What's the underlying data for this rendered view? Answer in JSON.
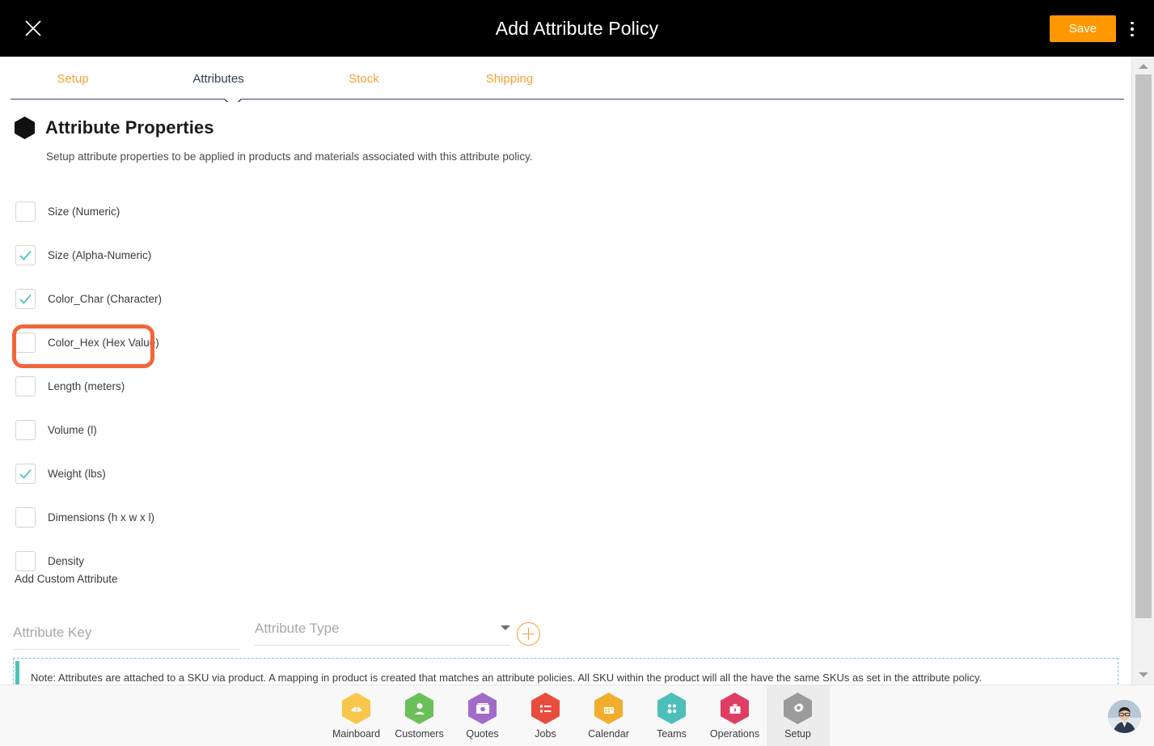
{
  "window": {
    "title": "Add Attribute Policy",
    "close_icon": "close-icon",
    "save_label": "Save",
    "menu_icon": "kebab-menu-icon",
    "accent_orange": "#FF9800",
    "tab_orange": "#F5A033",
    "highlight_orange": "#F2653A",
    "check_teal": "#52c2bd"
  },
  "tabs": [
    {
      "label": "Setup",
      "active": false
    },
    {
      "label": "Attributes",
      "active": true
    },
    {
      "label": "Stock",
      "active": false
    },
    {
      "label": "Shipping",
      "active": false
    }
  ],
  "section": {
    "icon": "hexagon-icon",
    "title": "Attribute Properties",
    "subtitle": "Setup attribute properties to be applied in products and materials associated with this attribute policy."
  },
  "attributes": [
    {
      "label": "Size (Numeric)",
      "checked": false,
      "highlighted": false
    },
    {
      "label": "Size (Alpha-Numeric)",
      "checked": true,
      "highlighted": true
    },
    {
      "label": "Color_Char (Character)",
      "checked": true,
      "highlighted": false
    },
    {
      "label": "Color_Hex (Hex Value)",
      "checked": false,
      "highlighted": false
    },
    {
      "label": "Length (meters)",
      "checked": false,
      "highlighted": false
    },
    {
      "label": "Volume (l)",
      "checked": false,
      "highlighted": false
    },
    {
      "label": "Weight (lbs)",
      "checked": true,
      "highlighted": false
    },
    {
      "label": "Dimensions (h x w x l)",
      "checked": false,
      "highlighted": false
    },
    {
      "label": "Density",
      "checked": false,
      "highlighted": false
    }
  ],
  "custom_attribute": {
    "heading": "Add Custom Attribute",
    "key_placeholder": "Attribute Key",
    "key_value": "",
    "type_placeholder": "Attribute Type",
    "type_value": "",
    "dropdown_icon": "chevron-down-icon",
    "add_icon": "plus-circle-icon"
  },
  "note": {
    "text": "Note: Attributes are attached to a SKU via product. A mapping in product is created that matches an attribute policies. All SKU within the product will all the have the same SKUs as set in the attribute policy."
  },
  "scrollbar": {
    "up_icon": "scroll-up-arrow-icon",
    "down_icon": "scroll-down-arrow-icon"
  },
  "bottom_nav": {
    "items": [
      {
        "label": "Mainboard",
        "icon": "mainboard-icon",
        "color": "#F7C64B",
        "active": false
      },
      {
        "label": "Customers",
        "icon": "customers-icon",
        "color": "#6BBF59",
        "active": false
      },
      {
        "label": "Quotes",
        "icon": "quotes-icon",
        "color": "#A06CC8",
        "active": false
      },
      {
        "label": "Jobs",
        "icon": "jobs-icon",
        "color": "#E84C3D",
        "active": false
      },
      {
        "label": "Calendar",
        "icon": "calendar-icon",
        "color": "#F0AD2E",
        "active": false
      },
      {
        "label": "Teams",
        "icon": "teams-icon",
        "color": "#4CBFBB",
        "active": false
      },
      {
        "label": "Operations",
        "icon": "operations-icon",
        "color": "#DE3E63",
        "active": false
      },
      {
        "label": "Setup",
        "icon": "gear-icon",
        "color": "#9B9B9B",
        "active": true
      }
    ],
    "avatar": "user-avatar"
  }
}
